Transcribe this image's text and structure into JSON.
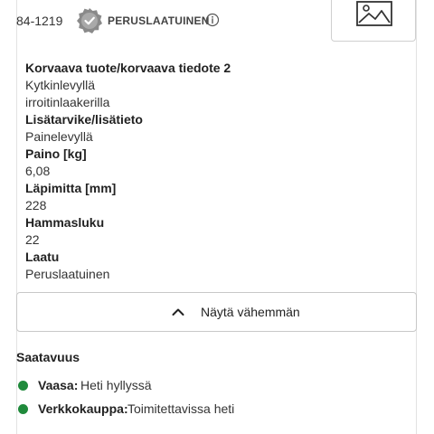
{
  "header": {
    "sku": "84-1219",
    "quality_label": "PERUSLAATUINEN",
    "seal_icon": "quality-seal-icon",
    "info_icon": "info-circle-icon",
    "image_icon": "image-placeholder-icon"
  },
  "specs": [
    {
      "label": "Korvaava tuote/korvaava tiedote 2",
      "values": [
        "Kytkinlevyllä",
        "irroitinlaakerilla"
      ]
    },
    {
      "label": "Lisätarvike/lisätieto",
      "values": [
        "Painelevyllä"
      ]
    },
    {
      "label": "Paino [kg]",
      "values": [
        "6,08"
      ]
    },
    {
      "label": "Läpimitta [mm]",
      "values": [
        "228"
      ]
    },
    {
      "label": "Hammasluku",
      "values": [
        "22"
      ]
    },
    {
      "label": "Laatu",
      "values": [
        "Peruslaatuinen"
      ]
    }
  ],
  "toggle": {
    "label": "Näytä vähemmän",
    "icon": "chevron-up-icon"
  },
  "availability": {
    "heading": "Saatavuus",
    "items": [
      {
        "label": "Vaasa:",
        "status": "Heti hyllyssä",
        "color": "#1f8a3b"
      },
      {
        "label": "Verkkokauppa:",
        "status": "Toimitettavissa heti",
        "color": "#1f8a3b"
      }
    ]
  },
  "colors": {
    "text": "#222222",
    "border": "#c8c8c8",
    "in_stock": "#1f8a3b"
  }
}
